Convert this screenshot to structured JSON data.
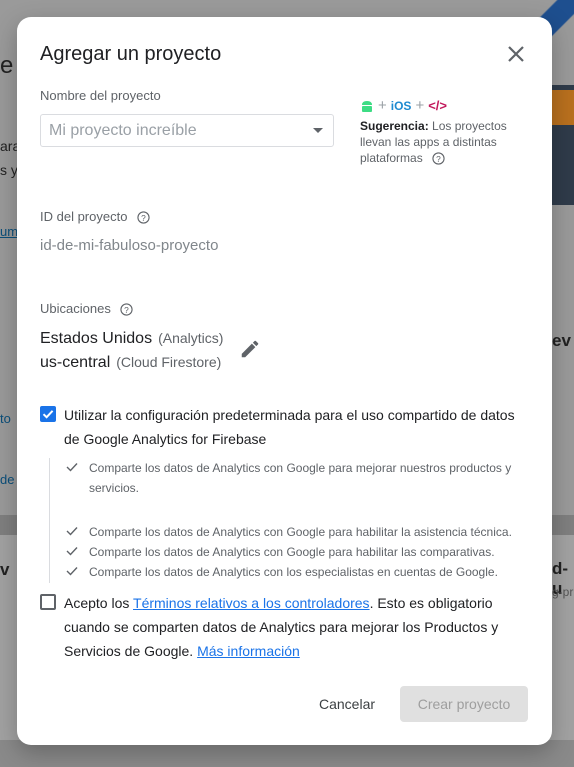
{
  "background": {
    "left_texts": [
      "e",
      "ara",
      "s y",
      "um",
      "to",
      "de"
    ],
    "right_texts": [
      "ev",
      "d-u",
      "g-pr"
    ],
    "bottom_left_text": "v"
  },
  "dialog": {
    "title": "Agregar un proyecto",
    "project_name": {
      "label": "Nombre del proyecto",
      "placeholder": "Mi proyecto increíble",
      "value": ""
    },
    "platforms": {
      "plus": "+",
      "ios": "iOS",
      "code": "</>"
    },
    "hint": {
      "bold": "Sugerencia:",
      "text": "Los proyectos llevan las apps a distintas plataformas"
    },
    "project_id": {
      "label": "ID del proyecto",
      "value": "id-de-mi-fabuloso-proyecto"
    },
    "locations": {
      "label": "Ubicaciones",
      "analytics": {
        "value": "Estados Unidos",
        "sub": "(Analytics)"
      },
      "firestore": {
        "value": "us-central",
        "sub": "(Cloud Firestore)"
      }
    },
    "sharing": {
      "checked": true,
      "label": "Utilizar la configuración predeterminada para el uso compartido de datos de Google Analytics for Firebase",
      "options": [
        "Comparte los datos de Analytics con Google para mejorar nuestros productos y servicios.",
        "Comparte los datos de Analytics con Google para habilitar la asistencia técnica.",
        "Comparte los datos de Analytics con Google para habilitar las comparativas.",
        "Comparte los datos de Analytics con los especialistas en cuentas de Google."
      ]
    },
    "terms": {
      "checked": false,
      "prefix": "Acepto los ",
      "link": "Términos relativos a los controladores",
      "middle": ". Esto es obligatorio cuando se comparten datos de Analytics para mejorar los Productos y Servicios de Google. ",
      "more_link": "Más información"
    },
    "buttons": {
      "cancel": "Cancelar",
      "create": "Crear proyecto"
    }
  },
  "colors": {
    "accent": "#1a73e8",
    "android": "#3ddc84",
    "ios": "#1e8ad0",
    "code": "#c2185b"
  }
}
